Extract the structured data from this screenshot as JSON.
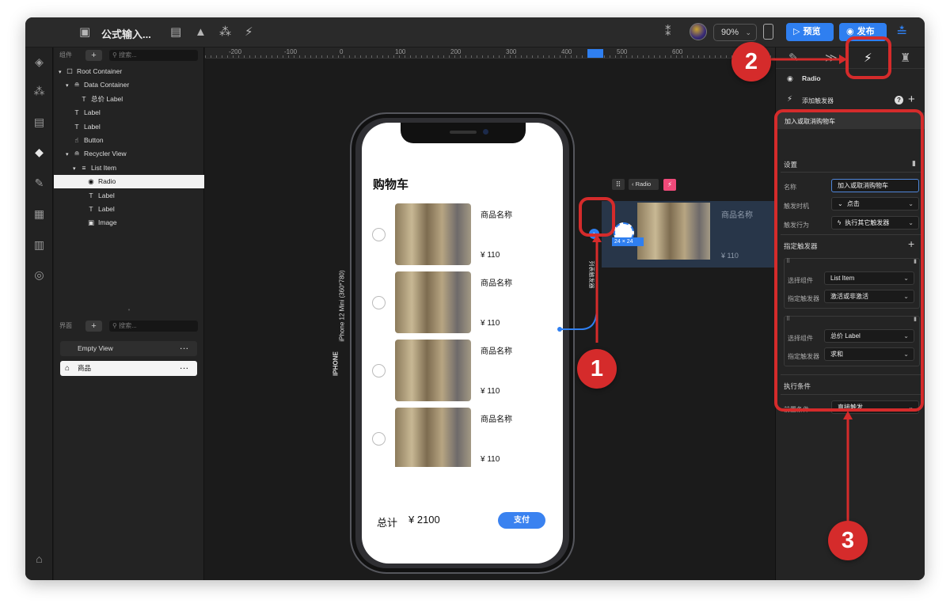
{
  "toolbar": {
    "doc_title": "公式输入...",
    "zoom": "90%",
    "preview_label": "预览",
    "publish_label": "发布"
  },
  "components_panel": {
    "title": "组件",
    "search_placeholder": "搜索...",
    "tree": [
      {
        "label": "Root Container",
        "depth": 0,
        "icon": "square-outline-icon",
        "glyph": "☐",
        "arrow": "▾"
      },
      {
        "label": "Data Container",
        "depth": 1,
        "icon": "database-icon",
        "glyph": "≘",
        "arrow": "▾"
      },
      {
        "label": "总价 Label",
        "depth": 2,
        "icon": "text-box-icon",
        "glyph": "T",
        "arrow": ""
      },
      {
        "label": "Label",
        "depth": 1,
        "icon": "text-box-icon",
        "glyph": "T",
        "arrow": ""
      },
      {
        "label": "Label",
        "depth": 1,
        "icon": "text-box-icon",
        "glyph": "T",
        "arrow": ""
      },
      {
        "label": "Button",
        "depth": 1,
        "icon": "pointer-hand-icon",
        "glyph": "☝",
        "arrow": ""
      },
      {
        "label": "Recycler View",
        "depth": 1,
        "icon": "list-database-icon",
        "glyph": "≘",
        "arrow": "▾"
      },
      {
        "label": "List Item",
        "depth": 2,
        "icon": "list-icon",
        "glyph": "≡",
        "arrow": "▾"
      },
      {
        "label": "Radio",
        "depth": 3,
        "icon": "radio-icon",
        "glyph": "◉",
        "arrow": "",
        "selected": true
      },
      {
        "label": "Label",
        "depth": 3,
        "icon": "text-box-icon",
        "glyph": "T",
        "arrow": ""
      },
      {
        "label": "Label",
        "depth": 3,
        "icon": "text-box-icon",
        "glyph": "T",
        "arrow": ""
      },
      {
        "label": "Image",
        "depth": 3,
        "icon": "image-icon",
        "glyph": "▣",
        "arrow": ""
      }
    ]
  },
  "pages_panel": {
    "title": "界面",
    "search_placeholder": "搜索...",
    "pages": [
      {
        "label": "Empty View",
        "home": false,
        "selected": false
      },
      {
        "label": "商品",
        "home": true,
        "selected": true
      }
    ]
  },
  "ruler": {
    "labels": [
      "-200",
      "-100",
      "0",
      "100",
      "200",
      "300",
      "400",
      "500",
      "600"
    ]
  },
  "device": {
    "vertical_label": "iPhone 12 Mini (360*780)",
    "brand_label": "IPHONE",
    "screen_title": "购物车",
    "items": [
      {
        "name": "商品名称",
        "price": "¥ 110"
      },
      {
        "name": "商品名称",
        "price": "¥ 110"
      },
      {
        "name": "商品名称",
        "price": "¥ 110"
      },
      {
        "name": "商品名称",
        "price": "¥ 110"
      }
    ],
    "total_label": "总计",
    "total_value": "¥ 2100",
    "pay_label": "支付"
  },
  "connector_label": "列表触发器",
  "preview_card": {
    "breadcrumb": "Radio",
    "item_name": "商品名称",
    "item_price": "¥ 110",
    "size_badge": "24 × 24"
  },
  "right_panel": {
    "component_name": "Radio",
    "add_trigger_label": "添加触发器",
    "trigger_title": "加入或取消购物车",
    "settings_label": "设置",
    "name_label": "名称",
    "name_value": "加入或取消购物车",
    "timing_label": "触发时机",
    "timing_value": "点击",
    "behavior_label": "触发行为",
    "behavior_value": "执行其它触发器",
    "target_section_label": "指定触发器",
    "targets": [
      {
        "select_label": "选择组件",
        "select_value": "List Item",
        "trigger_label": "指定触发器",
        "trigger_value": "激活或非激活"
      },
      {
        "select_label": "选择组件",
        "select_value": "总价 Label",
        "trigger_label": "指定触发器",
        "trigger_value": "求和"
      }
    ],
    "condition_section_label": "执行条件",
    "precondition_label": "前置条件",
    "precondition_value": "直接触发"
  },
  "annotations": [
    "1",
    "2",
    "3"
  ],
  "colors": {
    "annotation_red": "#d52b2b",
    "accent_blue": "#2f7ff0",
    "canvas_bg": "#1b1b1b",
    "panel_bg": "#242424"
  }
}
